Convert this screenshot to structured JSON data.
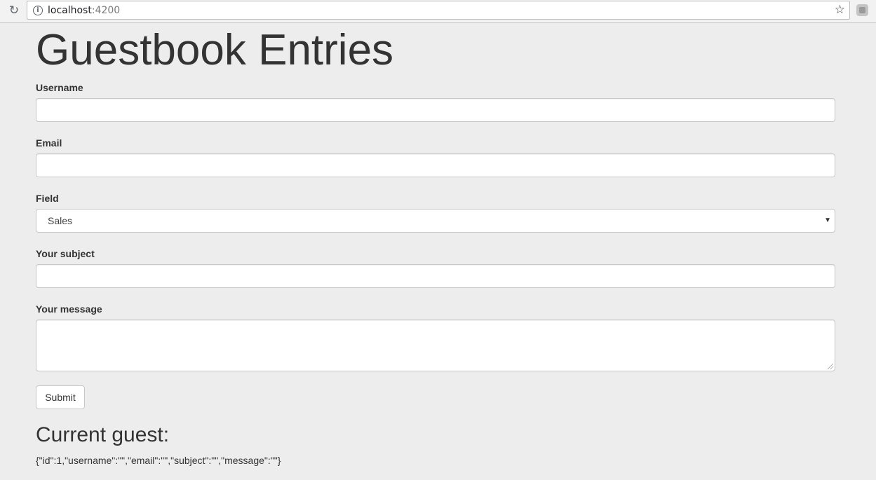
{
  "browser": {
    "url_host": "localhost",
    "url_port": ":4200",
    "reload_icon": "reload-icon",
    "info_icon": "info-icon",
    "star_icon": "star-icon"
  },
  "page": {
    "title": "Guestbook Entries",
    "form": {
      "username_label": "Username",
      "username_value": "",
      "email_label": "Email",
      "email_value": "",
      "field_label": "Field",
      "field_selected": "Sales",
      "subject_label": "Your subject",
      "subject_value": "",
      "message_label": "Your message",
      "message_value": "",
      "submit_label": "Submit"
    },
    "current_guest_heading": "Current guest:",
    "current_guest_json": "{\"id\":1,\"username\":\"\",\"email\":\"\",\"subject\":\"\",\"message\":\"\"}"
  }
}
